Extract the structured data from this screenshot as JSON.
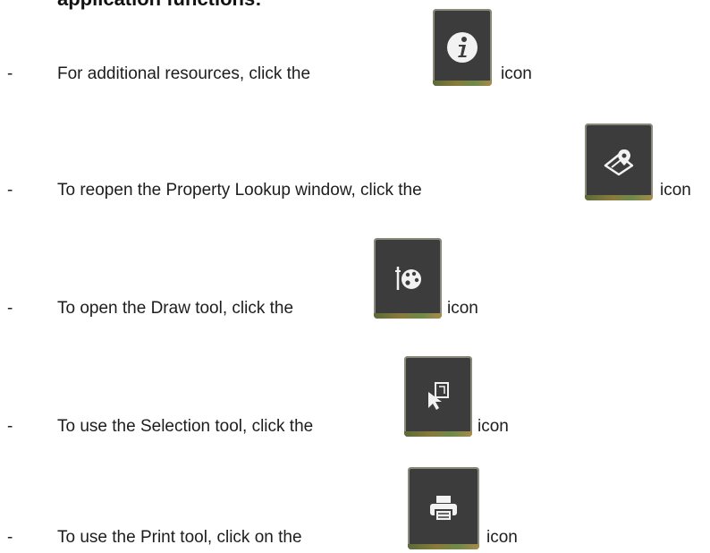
{
  "heading_fragment": "application functions:",
  "items": [
    {
      "dash": "-",
      "before": "For additional resources, click the",
      "after": "icon",
      "icon": "info-icon"
    },
    {
      "dash": "-",
      "before": "To reopen the Property Lookup window, click the",
      "after": "icon",
      "icon": "map-pin-icon"
    },
    {
      "dash": "-",
      "before": "To open the Draw tool, click the",
      "after": "icon",
      "icon": "palette-icon"
    },
    {
      "dash": "-",
      "before": "To use the Selection tool, click the",
      "after": "icon",
      "icon": "selection-cursor-icon"
    },
    {
      "dash": "-",
      "before": "To use the Print tool, click on the",
      "after": "icon",
      "icon": "printer-icon"
    }
  ],
  "colors": {
    "icon_bg": "#3c3c3c",
    "icon_fg": "#f2f2f2"
  }
}
